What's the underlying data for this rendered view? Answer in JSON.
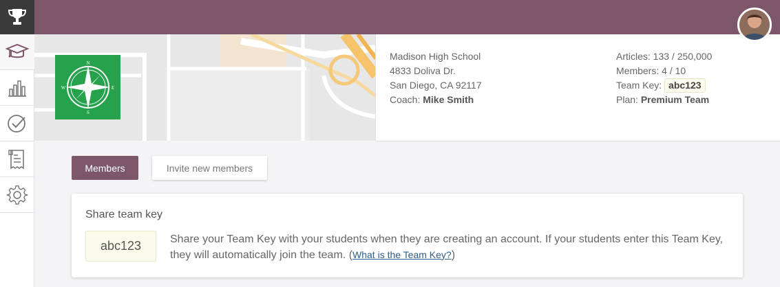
{
  "sidebar": {
    "items": [
      {
        "icon": "trophy-icon"
      },
      {
        "icon": "graduation-cap-icon"
      },
      {
        "icon": "bar-chart-icon"
      },
      {
        "icon": "checkmark-circle-icon"
      },
      {
        "icon": "receipt-icon"
      },
      {
        "icon": "gear-icon"
      }
    ]
  },
  "colors": {
    "brand": "#7b5769",
    "logo": "#26a24d",
    "link": "#2f5c88"
  },
  "school": {
    "name": "Madison High School",
    "address1": "4833 Doliva Dr.",
    "address2": "San Diego, CA 92117",
    "coach_label": "Coach:",
    "coach_name": "Mike Smith"
  },
  "stats": {
    "articles": "Articles: 133 / 250,000",
    "members": "Members: 4 / 10",
    "team_key_label": "Team Key:",
    "team_key": "abc123",
    "plan_label": "Plan:",
    "plan_value": "Premium Team"
  },
  "logo": {
    "n": "N",
    "s": "S",
    "e": "E",
    "w": "W"
  },
  "tabs": {
    "members": "Members",
    "invite": "Invite new members"
  },
  "share": {
    "title": "Share team key",
    "key": "abc123",
    "description": "Share your Team Key with your students when they are creating an account. If your students enter this Team Key, they will automatically join the team.",
    "paren_open": "(",
    "link": "What is the Team Key?",
    "paren_close": ")"
  }
}
